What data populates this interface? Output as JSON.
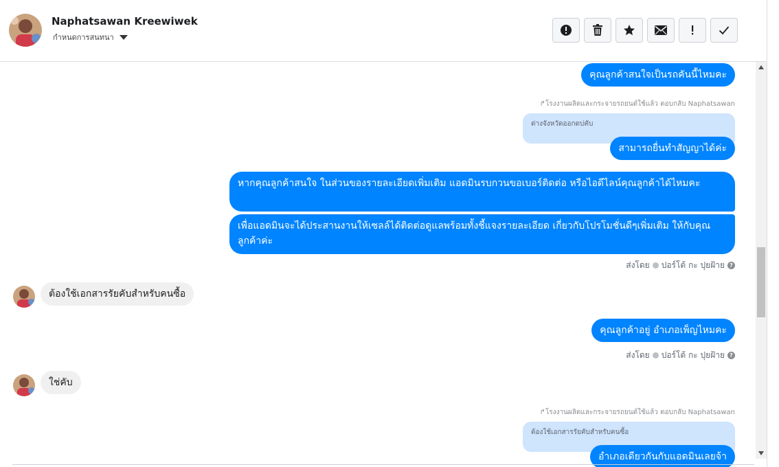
{
  "header": {
    "name": "Naphatsawan Kreewiwek",
    "subtitle": "กำหนดการสนทนา"
  },
  "toolbar": {
    "icons": [
      "alert-circle-icon",
      "trash-icon",
      "star-icon",
      "envelope-icon",
      "exclamation-icon",
      "checkmark-icon"
    ]
  },
  "messages": {
    "m1": "คุณลูกค้าสนใจเป็นรถคันนี้ไหมคะ",
    "reply1_meta": "โรงงานผลิตและกระจายรถยนต์ใช้แล้ว ตอบกลับ Naphatsawan",
    "quote1": "ต่างจังหวัดออกดบ่คับ",
    "m2": "สามารถยื่นทำสัญญาได้ค่ะ",
    "m3": "หากคุณลูกค้าสนใจ ในส่วนของรายละเอียดเพิ่มเติม แอดมินรบกวนขอเบอร์ติดต่อ หรือไอดีไลน์คุณลูกค้าได้ไหมคะ",
    "m4": "เพื่อแอดมินจะได้ประสานงานให้เซลล์ได้ติดต่อดูแลพร้อมทั้งชี้แจงรายละเอียด เกี่ยวกับโปรโมชั่นดีๆเพิ่มเติม ให้กับคุณลูกค้าค่ะ",
    "sent_by_1": "ส่งโดย",
    "sender_1": "ปอร์โต้ กะ ปุยฝ้าย",
    "in1": "ต้องใช้เอกสารรัยคับสำหรับคนซื้อ",
    "m5": "คุณลูกค้าอยู่ อำเภอเพ็ญไหมคะ",
    "sent_by_2": "ส่งโดย",
    "sender_2": "ปอร์โต้ กะ ปุยฝ้าย",
    "in2": "ใช่คับ",
    "reply2_meta": "โรงงานผลิตและกระจายรถยนต์ใช้แล้ว ตอบกลับ Naphatsawan",
    "quote2": "ต้องใช้เอกสารรัยคับสำหรับคนซื้อ",
    "m6": "อำเภอเดียวกันกับแอดมินเลยจ้า"
  },
  "colors": {
    "outgoing": "#0084ff",
    "incoming": "#f1f0f0",
    "quote": "#cfe4fd"
  }
}
